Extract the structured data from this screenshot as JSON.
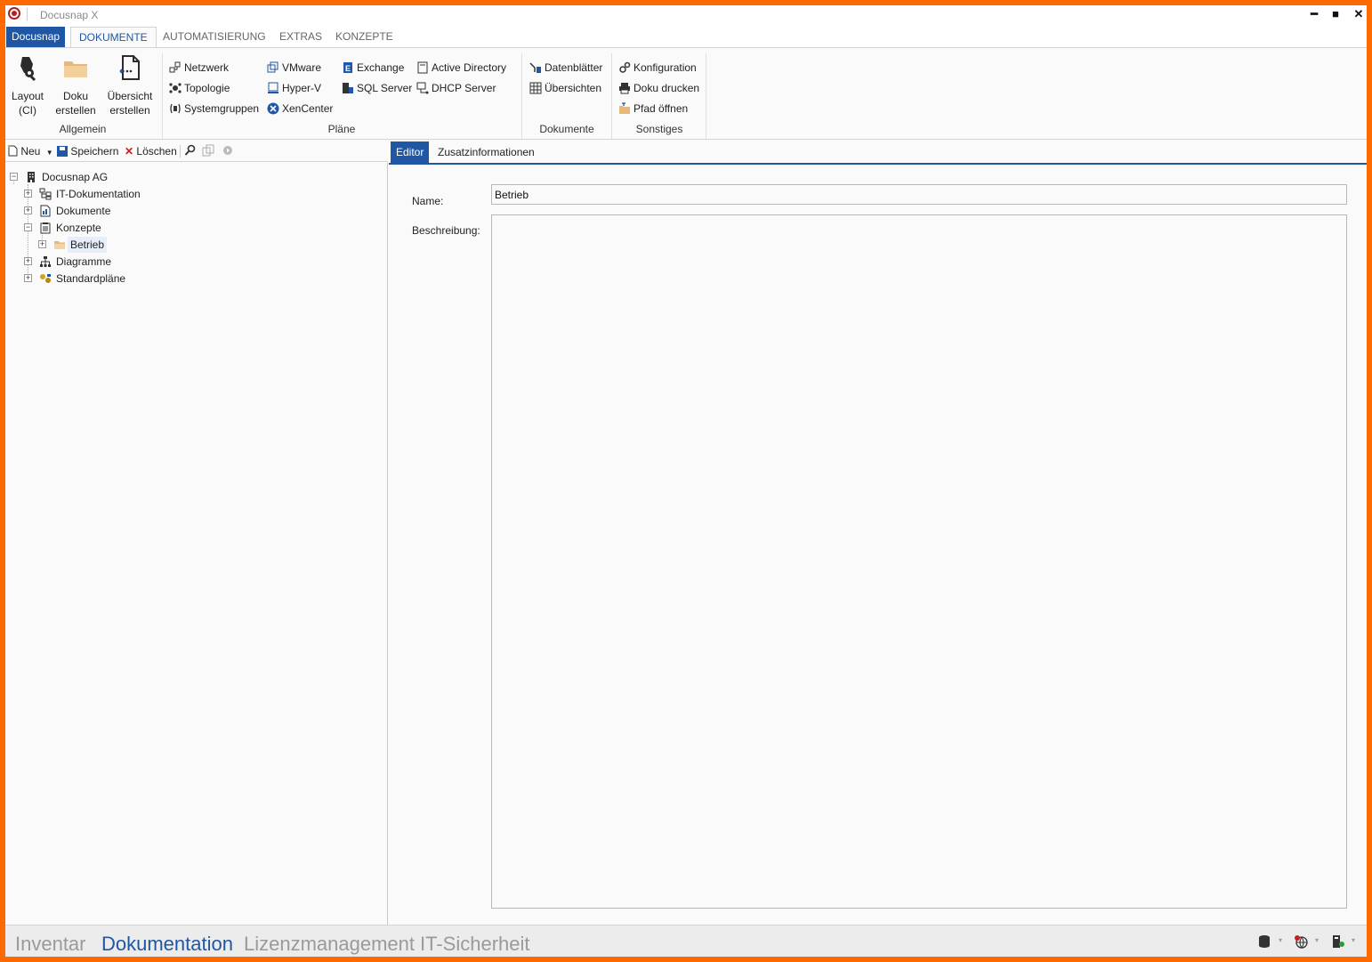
{
  "window": {
    "title": "Docusnap X",
    "minimize": "━",
    "maximize": "■",
    "close": "✕"
  },
  "ribbon_tabs": {
    "app": "Docusnap",
    "items": [
      "DOKUMENTE",
      "AUTOMATISIERUNG",
      "EXTRAS",
      "KONZEPTE"
    ]
  },
  "ribbon": {
    "allgemein": {
      "label": "Allgemein",
      "layout": "Layout\n(CI)",
      "layout_l1": "Layout",
      "layout_l2": "(CI)",
      "doku_l1": "Doku",
      "doku_l2": "erstellen",
      "uebersicht_l1": "Übersicht",
      "uebersicht_l2": "erstellen"
    },
    "plaene": {
      "label": "Pläne",
      "netzwerk": "Netzwerk",
      "topologie": "Topologie",
      "systemgruppen": "Systemgruppen",
      "vmware": "VMware",
      "hyperv": "Hyper-V",
      "xencenter": "XenCenter",
      "exchange": "Exchange",
      "sqlserver": "SQL Server",
      "activedirectory": "Active Directory",
      "dhcpserver": "DHCP Server"
    },
    "dokumente": {
      "label": "Dokumente",
      "datenblaetter": "Datenblätter",
      "uebersichten": "Übersichten"
    },
    "sonstiges": {
      "label": "Sonstiges",
      "konfiguration": "Konfiguration",
      "dokudrucken": "Doku drucken",
      "pfadoeffnen": "Pfad öffnen"
    }
  },
  "toolbar": {
    "new": "Neu",
    "save": "Speichern",
    "delete": "Löschen"
  },
  "tree": {
    "root": "Docusnap AG",
    "items": [
      "IT-Dokumentation",
      "Dokumente",
      "Konzepte",
      "Betrieb",
      "Diagramme",
      "Standardpläne"
    ]
  },
  "editor": {
    "tabs": [
      "Editor",
      "Zusatzinformationen"
    ],
    "name_label": "Name:",
    "name_value": "Betrieb",
    "description_label": "Beschreibung:",
    "description_value": ""
  },
  "bottom_nav": [
    "Inventar",
    "Dokumentation",
    "Lizenzmanagement",
    "IT-Sicherheit"
  ],
  "colors": {
    "frame": "#ff6a00",
    "accent": "#1f57a4",
    "tree_folder": "#f0c08a"
  }
}
